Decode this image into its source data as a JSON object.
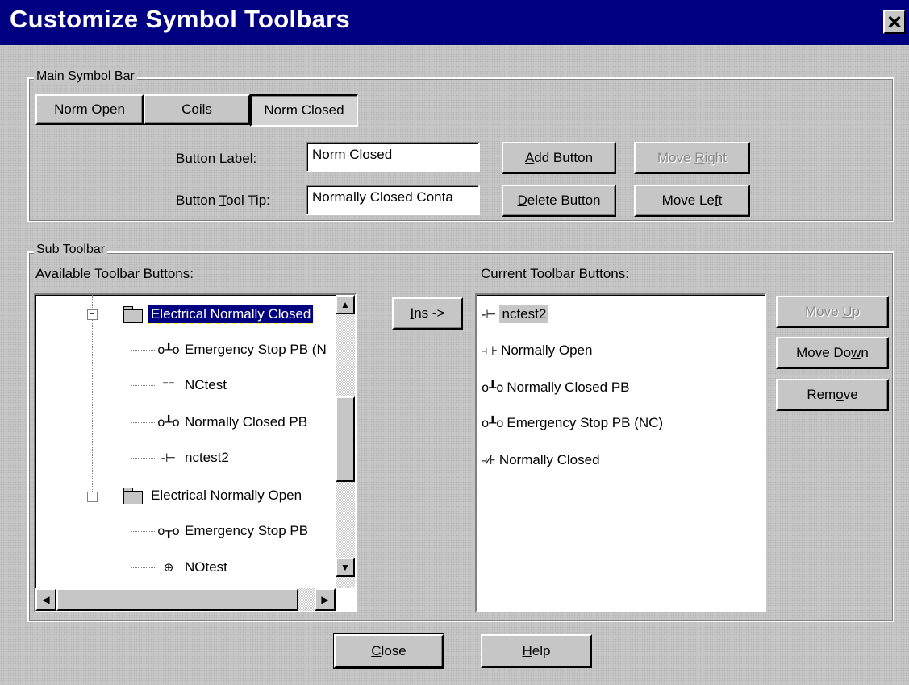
{
  "window": {
    "title": "Customize Symbol Toolbars",
    "close_glyph": "✕"
  },
  "main_bar": {
    "legend": "Main Symbol Bar",
    "tabs": [
      "Norm Open",
      "Coils",
      "Norm Closed"
    ],
    "selected_tab": "Norm Closed",
    "button_label_caption": "Button Label:",
    "button_label_value": "Norm Closed",
    "tooltip_caption": "Button Tool Tip:",
    "tooltip_value": "Normally Closed Conta",
    "add_button": "Add Button",
    "delete_button": "Delete Button",
    "move_right": "Move Right",
    "move_left": "Move Left"
  },
  "sub_toolbar": {
    "legend": "Sub Toolbar",
    "available_caption": "Available Toolbar Buttons:",
    "current_caption": "Current Toolbar Buttons:",
    "ins_button": "Ins ->",
    "tree": [
      {
        "label": "Electrical Normally Closed",
        "type": "folder-open",
        "selected": true,
        "symbol": ""
      },
      {
        "label": "Emergency Stop PB (N",
        "type": "leaf",
        "symbol": "o┸o"
      },
      {
        "label": "NCtest",
        "type": "leaf",
        "symbol": "⁼⁼"
      },
      {
        "label": "Normally Closed PB",
        "type": "leaf",
        "symbol": "o┸o"
      },
      {
        "label": "nctest2",
        "type": "leaf",
        "symbol": "-⊢"
      },
      {
        "label": "Electrical Normally Open",
        "type": "folder",
        "selected": false,
        "symbol": ""
      },
      {
        "label": "Emergency Stop PB",
        "type": "leaf",
        "symbol": "o┰o"
      },
      {
        "label": "NOtest",
        "type": "leaf",
        "symbol": "⊕"
      }
    ],
    "current_list": [
      {
        "label": "nctest2",
        "symbol": "-⊢",
        "highlighted": true
      },
      {
        "label": "Normally Open",
        "symbol": "⫞ ⊦"
      },
      {
        "label": "Normally Closed PB",
        "symbol": "o┸o"
      },
      {
        "label": "Emergency Stop PB (NC)",
        "symbol": "o┸o"
      },
      {
        "label": "Normally Closed",
        "symbol": "⫞⁄⊦"
      }
    ],
    "move_up": "Move Up",
    "move_down": "Move Down",
    "remove": "Remove"
  },
  "footer": {
    "close": "Close",
    "help": "Help"
  }
}
